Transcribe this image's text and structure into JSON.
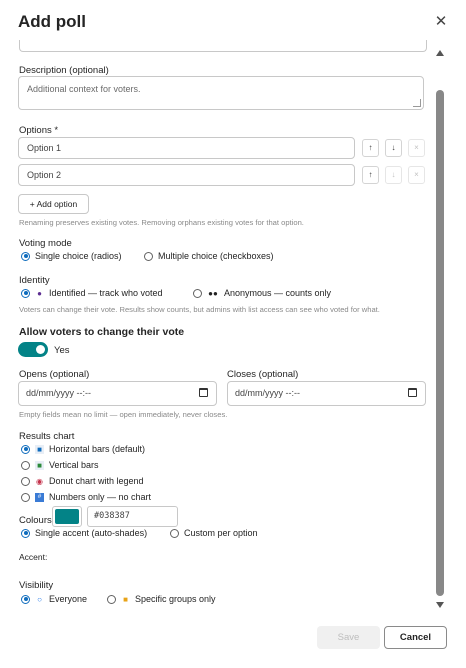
{
  "dialog": {
    "title": "Add poll",
    "close_label": "✕"
  },
  "description": {
    "label": "Description (optional)",
    "placeholder": "Additional context for voters."
  },
  "options": {
    "label": "Options *",
    "items": [
      {
        "value": "Option 1",
        "up": "↑",
        "down": "↓",
        "remove": "×"
      },
      {
        "value": "Option 2",
        "up": "↑",
        "down": "↓",
        "remove": "×"
      }
    ],
    "add_label": "+ Add option",
    "hint": "Renaming preserves existing votes. Removing orphans existing votes for that option."
  },
  "voting_mode": {
    "label": "Voting mode",
    "choices": [
      "Single choice (radios)",
      "Multiple choice (checkboxes)"
    ],
    "selected": 0
  },
  "identity": {
    "label": "Identity",
    "choices": [
      "Identified — track who voted",
      "Anonymous — counts only"
    ],
    "selected": 0,
    "hint": "Voters can change their vote. Results show counts, but admins with list access can see who voted for what."
  },
  "change_vote": {
    "label": "Allow voters to change their vote",
    "state_label": "Yes",
    "on": true
  },
  "opens": {
    "label": "Opens (optional)",
    "placeholder": "dd/mm/yyyy --:--"
  },
  "closes": {
    "label": "Closes (optional)",
    "placeholder": "dd/mm/yyyy --:--"
  },
  "dates_hint": "Empty fields mean no limit — open immediately, never closes.",
  "results_chart": {
    "label": "Results chart",
    "choices": [
      "Horizontal bars (default)",
      "Vertical bars",
      "Donut chart with legend",
      "Numbers only — no chart"
    ],
    "selected": 0
  },
  "colours": {
    "label": "Colours",
    "choices": [
      "Single accent (auto-shades)",
      "Custom per option"
    ],
    "selected": 0,
    "accent_label": "Accent:",
    "accent_value": "#038387"
  },
  "visibility": {
    "label": "Visibility",
    "choices": [
      "Everyone",
      "Specific groups only"
    ],
    "selected": 0
  },
  "footer": {
    "save_label": "Save",
    "cancel_label": "Cancel"
  },
  "colors": {
    "accent": "#038387",
    "primary": "#0f6cbd"
  }
}
